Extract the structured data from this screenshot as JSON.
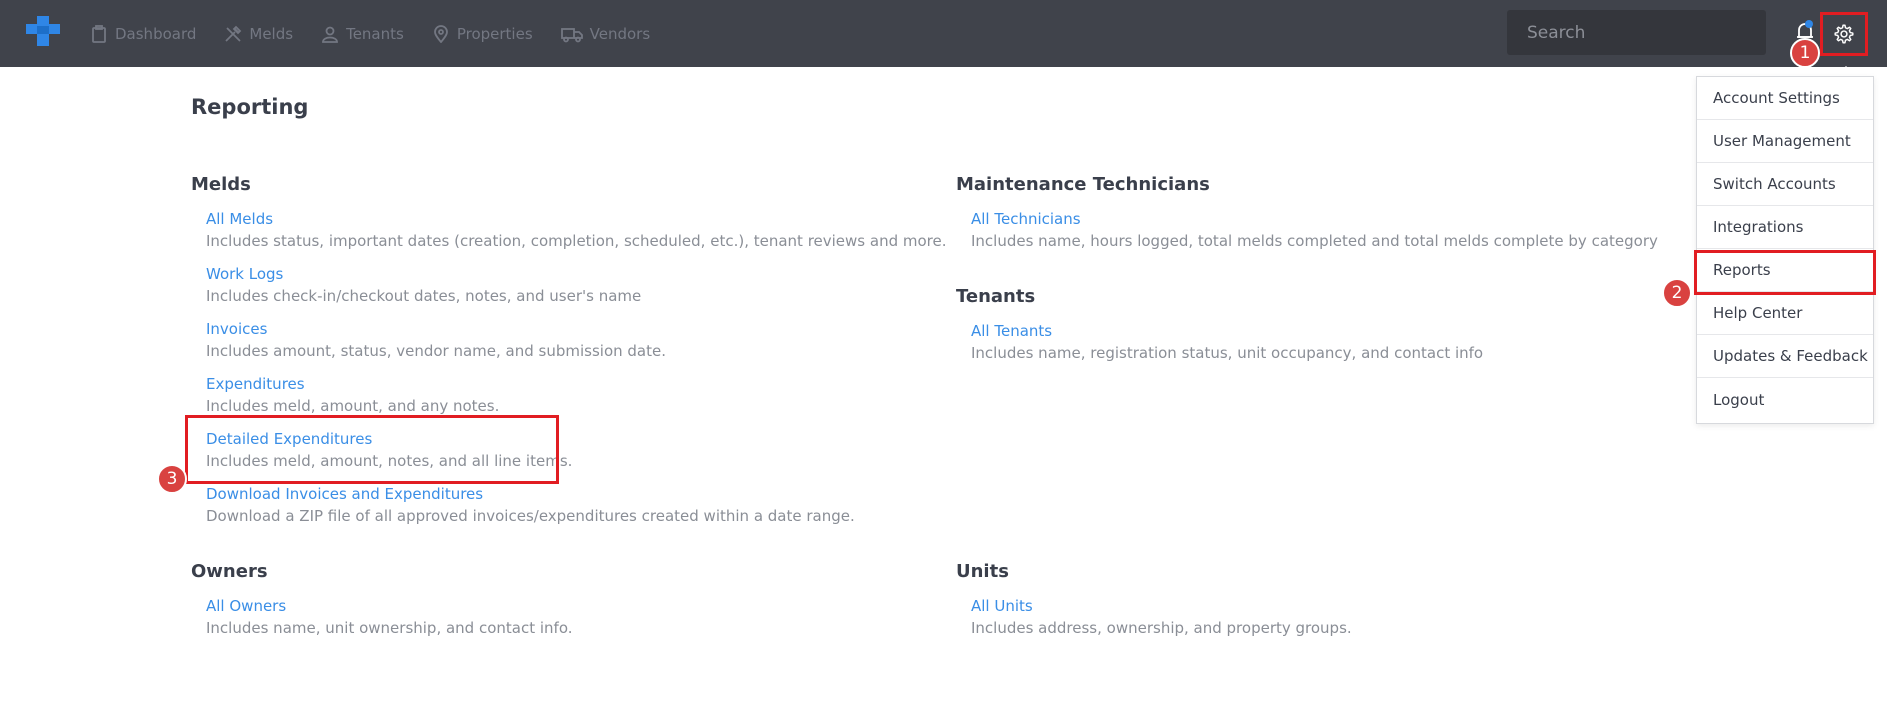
{
  "nav": {
    "items": [
      {
        "label": "Dashboard",
        "icon": "clipboard-icon"
      },
      {
        "label": "Melds",
        "icon": "tools-icon"
      },
      {
        "label": "Tenants",
        "icon": "person-icon"
      },
      {
        "label": "Properties",
        "icon": "map-pin-icon"
      },
      {
        "label": "Vendors",
        "icon": "truck-icon"
      }
    ],
    "search_placeholder": "Search"
  },
  "page": {
    "title": "Reporting"
  },
  "sections": {
    "melds": {
      "title": "Melds",
      "reports": [
        {
          "link": "All Melds",
          "desc": "Includes status, important dates (creation, completion, scheduled, etc.), tenant reviews and more."
        },
        {
          "link": "Work Logs",
          "desc": "Includes check-in/checkout dates, notes, and user's name"
        },
        {
          "link": "Invoices",
          "desc": "Includes amount, status, vendor name, and submission date."
        },
        {
          "link": "Expenditures",
          "desc": "Includes meld, amount, and any notes."
        },
        {
          "link": "Detailed Expenditures",
          "desc": "Includes meld, amount, notes, and all line items."
        },
        {
          "link": "Download Invoices and Expenditures",
          "desc": "Download a ZIP file of all approved invoices/expenditures created within a date range."
        }
      ]
    },
    "technicians": {
      "title": "Maintenance Technicians",
      "reports": [
        {
          "link": "All Technicians",
          "desc": "Includes name, hours logged, total melds completed and total melds complete by category"
        }
      ]
    },
    "tenants": {
      "title": "Tenants",
      "reports": [
        {
          "link": "All Tenants",
          "desc": "Includes name, registration status, unit occupancy, and contact info"
        }
      ]
    },
    "owners": {
      "title": "Owners",
      "reports": [
        {
          "link": "All Owners",
          "desc": "Includes name, unit ownership, and contact info."
        }
      ]
    },
    "units": {
      "title": "Units",
      "reports": [
        {
          "link": "All Units",
          "desc": "Includes address, ownership, and property groups."
        }
      ]
    }
  },
  "dropdown": {
    "items": [
      "Account Settings",
      "User Management",
      "Switch Accounts",
      "Integrations",
      "Reports",
      "Help Center",
      "Updates & Feedback",
      "Logout"
    ]
  },
  "annotations": [
    "1",
    "2",
    "3"
  ],
  "colors": {
    "topbar": "#40434b",
    "link": "#3a8ee6",
    "highlight": "#e11d22",
    "badge": "#d94240",
    "brand": "#2f86e6"
  }
}
